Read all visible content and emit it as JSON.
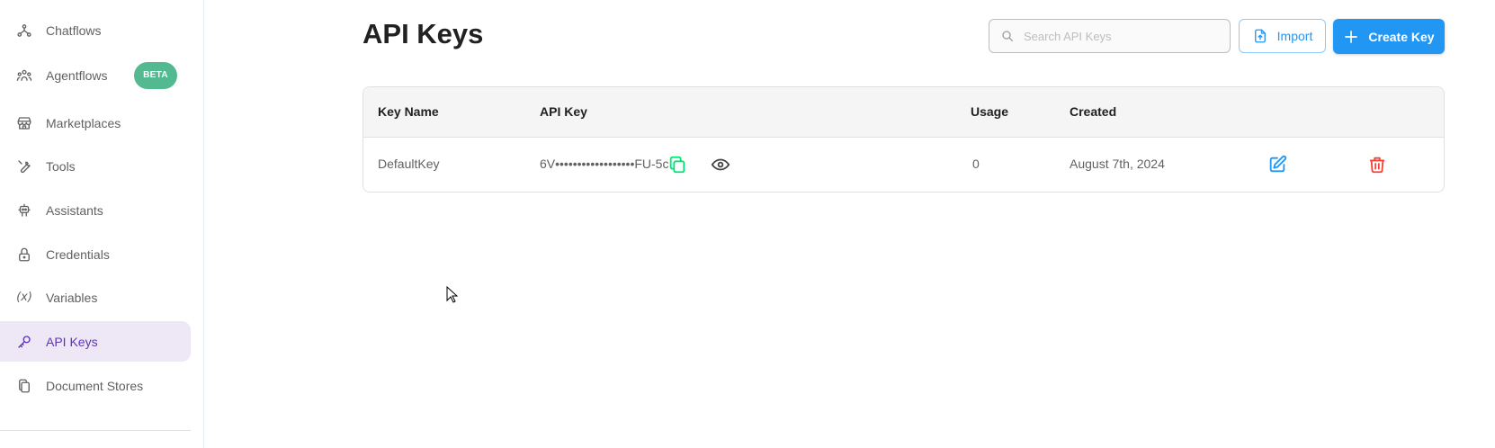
{
  "sidebar": {
    "items": [
      {
        "label": "Chatflows",
        "icon": "chatflows-icon"
      },
      {
        "label": "Agentflows",
        "icon": "agentflows-icon",
        "badge": "BETA"
      },
      {
        "label": "Marketplaces",
        "icon": "marketplace-icon"
      },
      {
        "label": "Tools",
        "icon": "tool-icon"
      },
      {
        "label": "Assistants",
        "icon": "robot-icon"
      },
      {
        "label": "Credentials",
        "icon": "lock-icon"
      },
      {
        "label": "Variables",
        "icon": "variable-icon",
        "glyph": "(x)"
      },
      {
        "label": "API Keys",
        "icon": "key-icon",
        "active": true
      },
      {
        "label": "Document Stores",
        "icon": "files-icon"
      }
    ]
  },
  "header": {
    "title": "API Keys",
    "search_placeholder": "Search API Keys",
    "import_label": "Import",
    "create_label": "Create Key"
  },
  "table": {
    "columns": [
      "Key Name",
      "API Key",
      "Usage",
      "Created"
    ],
    "rows": [
      {
        "name": "DefaultKey",
        "api_key": "6V••••••••••••••••••FU-5c",
        "usage": "0",
        "created": "August 7th, 2024"
      }
    ]
  },
  "colors": {
    "primary": "#2196f3",
    "active_nav_bg": "#ede7f6",
    "active_nav_fg": "#5e35b1",
    "beta_badge": "#53b990",
    "copy_icon": "#00e676",
    "edit_icon": "#2196f3",
    "delete_icon": "#f44336"
  }
}
